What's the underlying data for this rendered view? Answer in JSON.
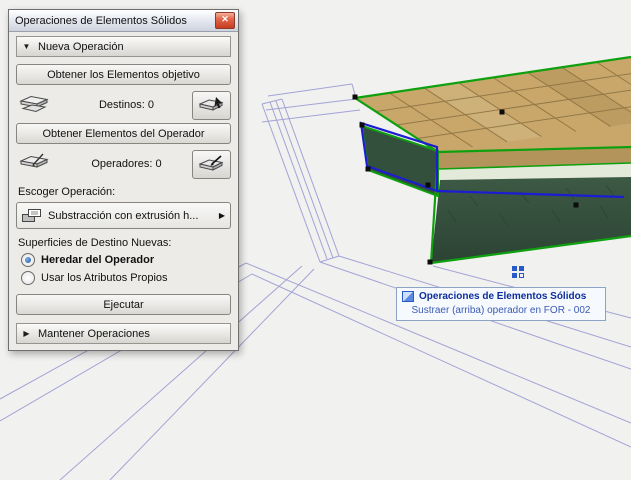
{
  "window": {
    "title": "Operaciones de Elementos Sólidos"
  },
  "icons": {
    "close": "✕",
    "section_expanded": "▼",
    "section_collapsed": "▶",
    "flyout_arrow": "▶"
  },
  "panel": {
    "section_new_operation": "Nueva Operación",
    "get_targets_button": "Obtener los Elementos objetivo",
    "targets_count": "Destinos: 0",
    "get_operators_button": "Obtener Elementos del Operador",
    "operators_count": "Operadores: 0",
    "choose_operation_label": "Escoger Operación:",
    "operation_value": "Substracción con extrusión h...",
    "surfaces_label": "Superficies de Destino Nuevas:",
    "radio_inherit": "Heredar del Operador",
    "radio_inherit_selected": true,
    "radio_own": "Usar los Atributos Propios",
    "radio_own_selected": false,
    "execute_button": "Ejecutar",
    "section_keep_operations": "Mantener Operaciones"
  },
  "tooltip": {
    "title": "Operaciones de Elementos Sólidos",
    "detail": "Sustraer (arriba) operador en FOR - 002"
  },
  "colors": {
    "selection_green": "#0fa00f",
    "operator_blue": "#1c1cd2",
    "wireframe_purple": "#a3a3d6",
    "wood_top": "#c9a76a",
    "slab_side_dark": "#35503c"
  }
}
